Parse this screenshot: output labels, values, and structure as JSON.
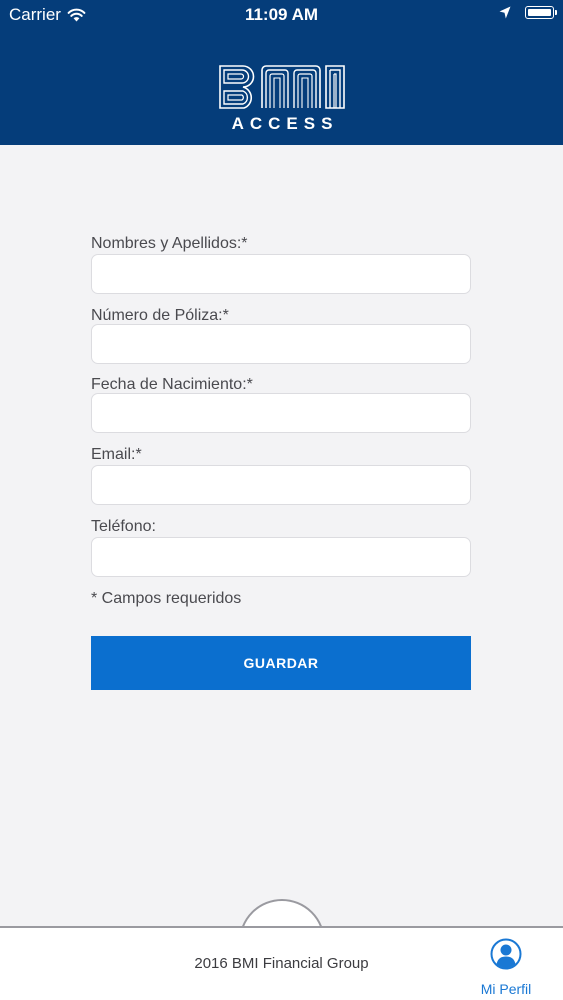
{
  "status_bar": {
    "carrier": "Carrier",
    "time": "11:09 AM",
    "icons": [
      "wifi-icon",
      "location-arrow-icon",
      "battery-icon"
    ]
  },
  "header": {
    "logo_text": "BMI",
    "logo_subtext": "ACCESS",
    "background_color": "#053d7a"
  },
  "form": {
    "fields": [
      {
        "label": "Nombres y Apellidos:*",
        "value": "",
        "placeholder": ""
      },
      {
        "label": "Número de Póliza:*",
        "value": "",
        "placeholder": ""
      },
      {
        "label": "Fecha de Nacimiento:*",
        "value": "",
        "placeholder": ""
      },
      {
        "label": "Email:*",
        "value": "",
        "placeholder": ""
      },
      {
        "label": "Teléfono:",
        "value": "",
        "placeholder": ""
      }
    ],
    "required_note": "* Campos requeridos",
    "save_label": "GUARDAR",
    "button_color": "#0b6fcf"
  },
  "footer": {
    "copyright": "2016 BMI Financial Group",
    "tabs": [
      {
        "label": "Mi Perfil",
        "icon": "user-profile-icon",
        "active": true,
        "color": "#1a78d4"
      }
    ]
  }
}
